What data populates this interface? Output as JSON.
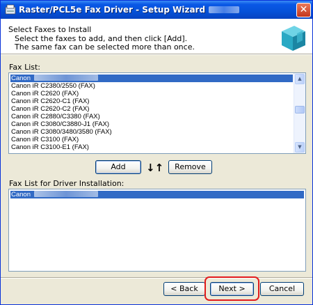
{
  "window": {
    "title": "Raster/PCL5e Fax Driver - Setup Wizard",
    "title_blurred_suffix": "Ver. 8.30",
    "close_label": "✕"
  },
  "header": {
    "title": "Select Faxes to Install",
    "line1": "Select the faxes to add, and then click [Add].",
    "line2": "The same fax can be selected more than once."
  },
  "fax_list": {
    "label": "Fax List:",
    "items": [
      "Canon",
      "Canon iR C2380/2550 (FAX)",
      "Canon iR C2620 (FAX)",
      "Canon iR C2620-C1 (FAX)",
      "Canon iR C2620-C2 (FAX)",
      "Canon iR C2880/C3380 (FAX)",
      "Canon iR C3080/C3880-J1 (FAX)",
      "Canon iR C3080/3480/3580 (FAX)",
      "Canon iR C3100 (FAX)",
      "Canon iR C3100-E1 (FAX)"
    ],
    "selected_index": 0
  },
  "actions": {
    "add_label": "Add",
    "arrows": "↓↑",
    "remove_label": "Remove"
  },
  "install_list": {
    "label": "Fax List for Driver Installation:",
    "items": [
      "Canon"
    ],
    "selected_index": 0
  },
  "footer": {
    "back_label": "< Back",
    "next_label": "Next >",
    "cancel_label": "Cancel"
  },
  "colors": {
    "titlebar": "#0551d8",
    "selection": "#316ac5",
    "highlight_ring": "#e21b1b"
  }
}
